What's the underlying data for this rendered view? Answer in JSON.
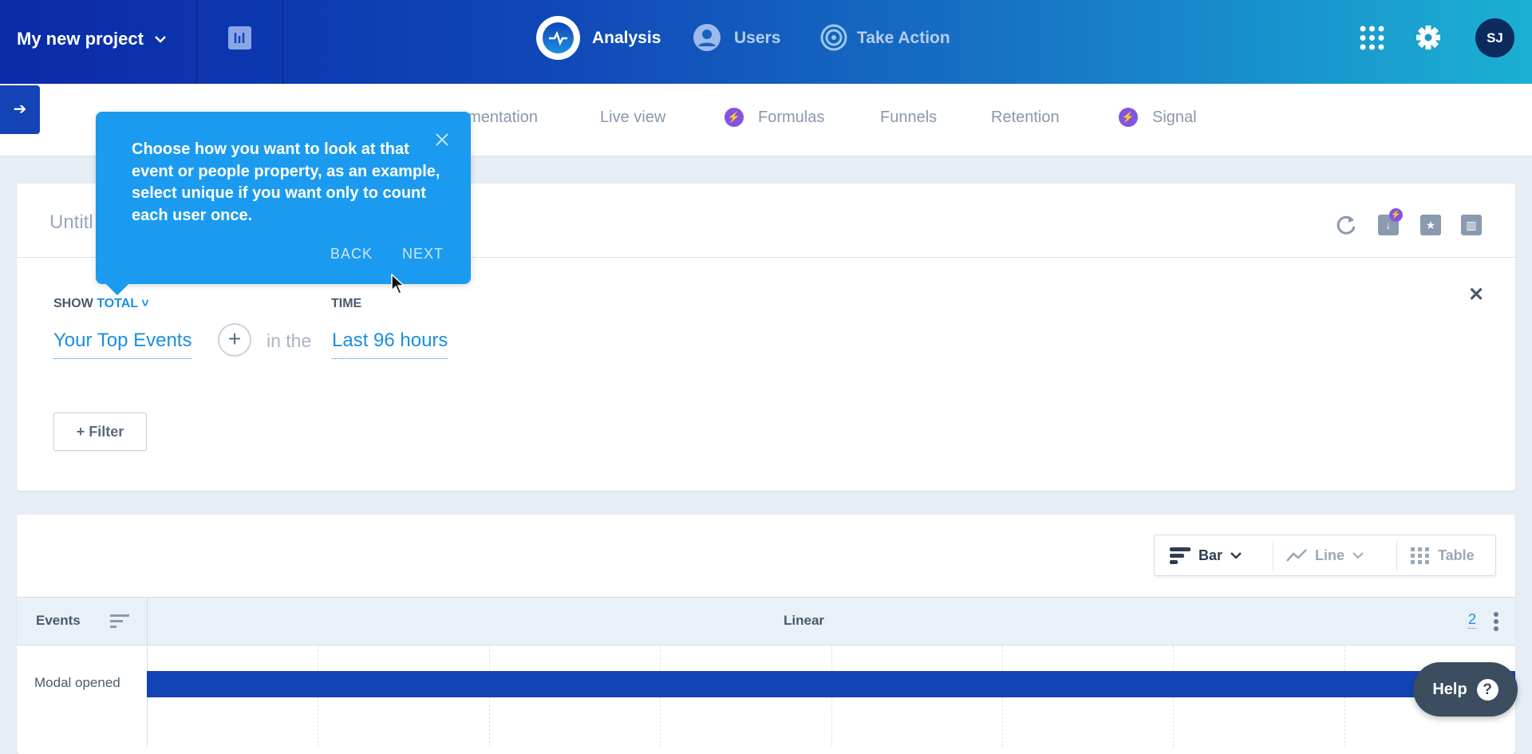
{
  "header": {
    "project": "My new project",
    "nav": [
      {
        "label": "Analysis",
        "icon": "analysis-pulse-icon",
        "active": true
      },
      {
        "label": "Users",
        "icon": "user-icon",
        "active": false
      },
      {
        "label": "Take Action",
        "icon": "target-icon",
        "active": false
      }
    ],
    "avatar_initials": "SJ"
  },
  "subnav": {
    "tabs": [
      {
        "label": "umentation"
      },
      {
        "label": "Live view"
      },
      {
        "label": "Formulas",
        "badge": "bolt"
      },
      {
        "label": "Funnels"
      },
      {
        "label": "Retention"
      },
      {
        "label": "Signal",
        "badge": "bolt"
      }
    ]
  },
  "query": {
    "title": "Untitl",
    "show_label": "SHOW",
    "show_value": "TOTAL",
    "time_label": "TIME",
    "events": "Your Top Events",
    "in_the": "in the",
    "time_value": "Last 96 hours",
    "filter_button": "+ Filter"
  },
  "tooltip": {
    "text": "Choose how you want to look at that event or people property, as an example, select unique if you want only to count each user once.",
    "back": "BACK",
    "next": "NEXT"
  },
  "chart_controls": {
    "bar": "Bar",
    "line": "Line",
    "table": "Table",
    "selected": "Bar"
  },
  "table": {
    "events_header": "Events",
    "scale_header": "Linear",
    "count": "2",
    "rows": [
      {
        "label": "Modal opened",
        "fraction": 1.0
      }
    ]
  },
  "help": {
    "label": "Help"
  },
  "colors": {
    "accent": "#1a8fe0",
    "bar": "#1343b5",
    "tooltip": "#1a9bf0",
    "bolt": "#8354e0"
  }
}
